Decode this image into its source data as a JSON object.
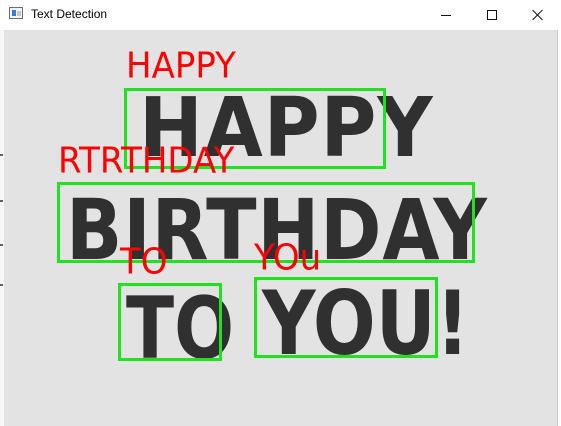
{
  "window": {
    "title": "Text Detection",
    "icons": {
      "app": "app-icon",
      "minimize": "minimize-icon",
      "maximize": "maximize-icon",
      "close": "close-icon"
    }
  },
  "image": {
    "handwritten_lines": [
      "HAPPY",
      "BIRTHDAY",
      "TO",
      "YOU!"
    ],
    "detections": [
      {
        "text": "HAPPY"
      },
      {
        "text": "RTRTHDAY"
      },
      {
        "text": "TO"
      },
      {
        "text": "YOu"
      }
    ],
    "colors": {
      "box": "#1ee31e",
      "label": "#ff0000",
      "ink": "#303030",
      "background": "#e3e3e3"
    }
  }
}
